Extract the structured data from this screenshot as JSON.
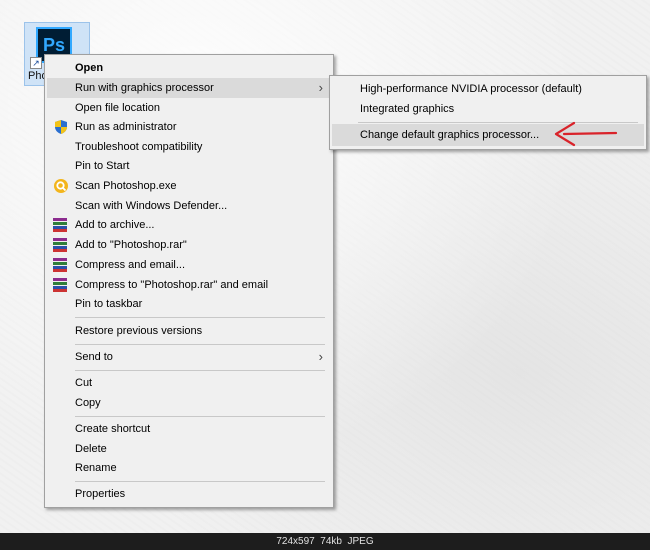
{
  "desktop": {
    "icon_label": "Pho",
    "icon_badge": "Ps"
  },
  "context_menu": {
    "items": [
      {
        "label": "Open"
      },
      {
        "label": "Run with graphics processor"
      },
      {
        "label": "Open file location"
      },
      {
        "label": "Run as administrator"
      },
      {
        "label": "Troubleshoot compatibility"
      },
      {
        "label": "Pin to Start"
      },
      {
        "label": "Scan Photoshop.exe"
      },
      {
        "label": "Scan with Windows Defender..."
      },
      {
        "label": "Add to archive..."
      },
      {
        "label": "Add to \"Photoshop.rar\""
      },
      {
        "label": "Compress and email..."
      },
      {
        "label": "Compress to \"Photoshop.rar\" and email"
      },
      {
        "label": "Pin to taskbar"
      },
      {
        "label": "Restore previous versions"
      },
      {
        "label": "Send to"
      },
      {
        "label": "Cut"
      },
      {
        "label": "Copy"
      },
      {
        "label": "Create shortcut"
      },
      {
        "label": "Delete"
      },
      {
        "label": "Rename"
      },
      {
        "label": "Properties"
      }
    ]
  },
  "submenu": {
    "items": [
      {
        "label": "High-performance NVIDIA processor (default)"
      },
      {
        "label": "Integrated graphics"
      },
      {
        "label": "Change default graphics processor..."
      }
    ]
  },
  "annotation": {
    "arrow_color": "#d9232a"
  },
  "footer": {
    "text": "724x597  74kb  JPEG"
  },
  "colors": {
    "menu_bg": "#f0f0f0",
    "highlight": "#dadada",
    "ps_blue": "#31a8ff"
  }
}
